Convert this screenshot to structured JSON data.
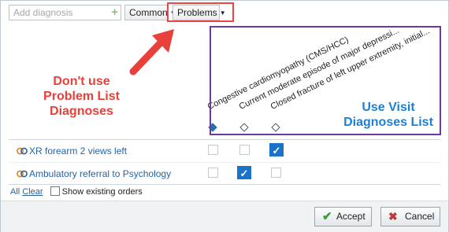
{
  "toolbar": {
    "search_placeholder": "Add diagnosis",
    "add_icon": "plus-icon",
    "common_label": "Common",
    "problems_label": "Problems"
  },
  "diagnoses": [
    "Congestive cardiomyopathy (CMS/HCC)",
    "Current moderate episode of major depressi...",
    "Closed fracture of left upper extremity, initial..."
  ],
  "annotations": {
    "red_note_lines": [
      "Don't use",
      "Problem List",
      "Diagnoses"
    ],
    "blue_note_lines": [
      "Use Visit",
      "Diagnoses List"
    ],
    "red_color": "#e8413c",
    "blue_color": "#1e7fd6",
    "purple_color": "#6f3aa0"
  },
  "orders": [
    {
      "label": "XR forearm 2 views left",
      "checks": [
        false,
        false,
        true
      ]
    },
    {
      "label": "Ambulatory referral to Psychology",
      "checks": [
        false,
        true,
        false
      ]
    }
  ],
  "links": {
    "all": "All",
    "clear": "Clear",
    "show_existing": "Show existing orders"
  },
  "footer": {
    "accept_label": "Accept",
    "cancel_label": "Cancel"
  }
}
